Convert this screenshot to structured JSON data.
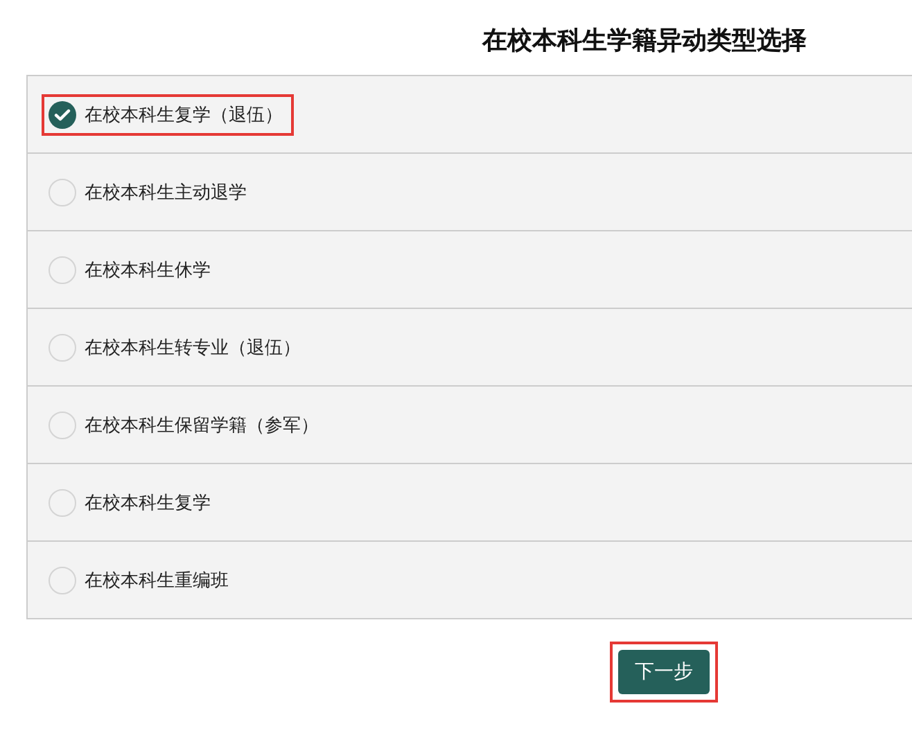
{
  "title": "在校本科生学籍异动类型选择",
  "options": [
    {
      "label": "在校本科生复学（退伍）",
      "selected": true,
      "highlighted": true
    },
    {
      "label": "在校本科生主动退学",
      "selected": false,
      "highlighted": false
    },
    {
      "label": "在校本科生休学",
      "selected": false,
      "highlighted": false
    },
    {
      "label": "在校本科生转专业（退伍）",
      "selected": false,
      "highlighted": false
    },
    {
      "label": "在校本科生保留学籍（参军）",
      "selected": false,
      "highlighted": false
    },
    {
      "label": "在校本科生复学",
      "selected": false,
      "highlighted": false
    },
    {
      "label": "在校本科生重编班",
      "selected": false,
      "highlighted": false
    }
  ],
  "next_button": {
    "label": "下一步",
    "highlighted": true
  }
}
